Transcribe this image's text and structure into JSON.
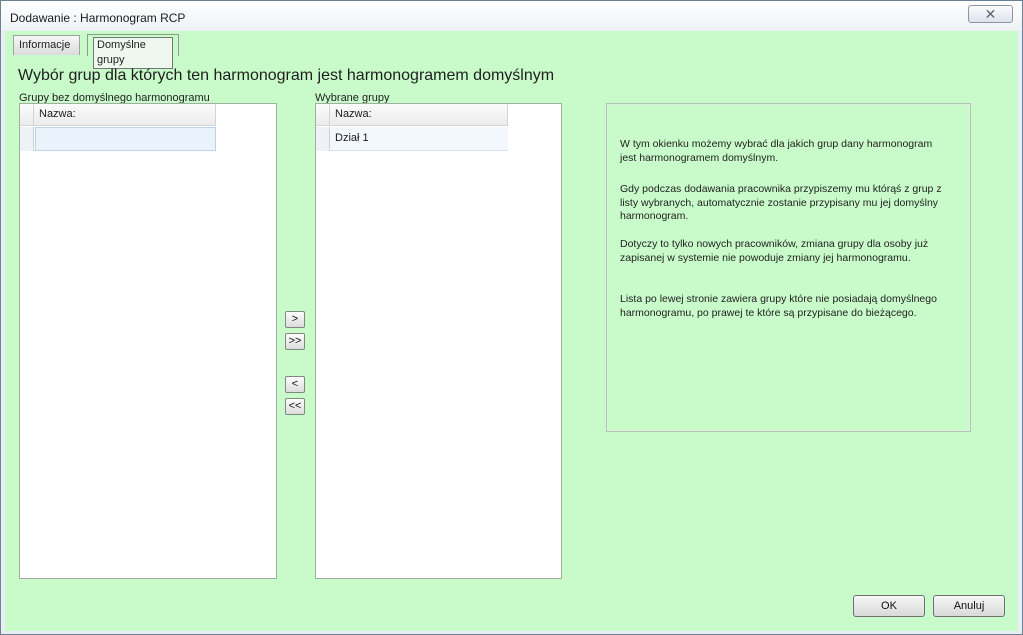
{
  "window": {
    "title": "Dodawanie : Harmonogram RCP",
    "close_glyph": "✕"
  },
  "tabs": [
    {
      "label": "Informacje"
    },
    {
      "label": "Domyślne grupy"
    }
  ],
  "heading": "Wybór grup dla których ten harmonogram jest harmonogramem domyślnym",
  "left_list": {
    "label": "Grupy bez domyślnego harmonogramu",
    "column": "Nazwa:",
    "rows": [
      ""
    ]
  },
  "right_list": {
    "label": "Wybrane grupy",
    "column": "Nazwa:",
    "rows": [
      "Dział 1"
    ]
  },
  "transfer_buttons": {
    "add_one": ">",
    "add_all": ">>",
    "remove_one": "<",
    "remove_all": "<<"
  },
  "info": {
    "p1": "W tym okienku możemy wybrać dla jakich grup dany harmonogram jest harmonogramem domyślnym.",
    "p2": "Gdy podczas dodawania pracownika przypiszemy mu którąś z grup z listy wybranych, automatycznie zostanie przypisany mu jej domyślny harmonogram.",
    "p3": "Dotyczy to tylko nowych pracowników, zmiana grupy dla osoby już zapisanej w systemie nie powoduje zmiany jej harmonogramu.",
    "p4": "Lista po lewej stronie zawiera grupy które nie posiadają domyślnego harmonogramu, po prawej te które są przypisane do bieżącego."
  },
  "buttons": {
    "ok": "OK",
    "cancel": "Anuluj"
  },
  "colors": {
    "client_bg": "#c8fbc9",
    "row_highlight": "#eaf3fc"
  }
}
